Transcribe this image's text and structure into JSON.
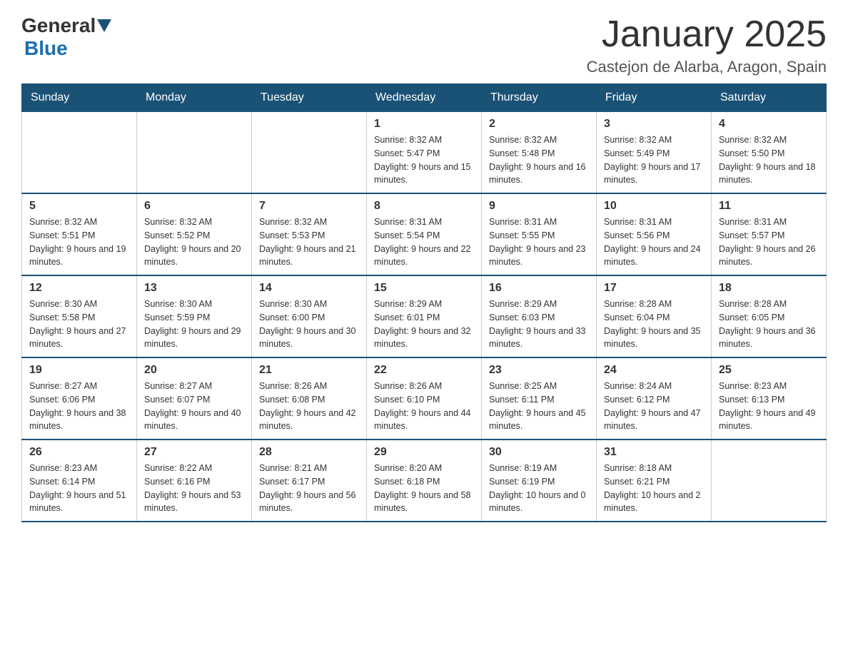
{
  "logo": {
    "general": "General",
    "blue": "Blue"
  },
  "title": "January 2025",
  "location": "Castejon de Alarba, Aragon, Spain",
  "headers": [
    "Sunday",
    "Monday",
    "Tuesday",
    "Wednesday",
    "Thursday",
    "Friday",
    "Saturday"
  ],
  "weeks": [
    [
      {
        "day": "",
        "info": ""
      },
      {
        "day": "",
        "info": ""
      },
      {
        "day": "",
        "info": ""
      },
      {
        "day": "1",
        "info": "Sunrise: 8:32 AM\nSunset: 5:47 PM\nDaylight: 9 hours and 15 minutes."
      },
      {
        "day": "2",
        "info": "Sunrise: 8:32 AM\nSunset: 5:48 PM\nDaylight: 9 hours and 16 minutes."
      },
      {
        "day": "3",
        "info": "Sunrise: 8:32 AM\nSunset: 5:49 PM\nDaylight: 9 hours and 17 minutes."
      },
      {
        "day": "4",
        "info": "Sunrise: 8:32 AM\nSunset: 5:50 PM\nDaylight: 9 hours and 18 minutes."
      }
    ],
    [
      {
        "day": "5",
        "info": "Sunrise: 8:32 AM\nSunset: 5:51 PM\nDaylight: 9 hours and 19 minutes."
      },
      {
        "day": "6",
        "info": "Sunrise: 8:32 AM\nSunset: 5:52 PM\nDaylight: 9 hours and 20 minutes."
      },
      {
        "day": "7",
        "info": "Sunrise: 8:32 AM\nSunset: 5:53 PM\nDaylight: 9 hours and 21 minutes."
      },
      {
        "day": "8",
        "info": "Sunrise: 8:31 AM\nSunset: 5:54 PM\nDaylight: 9 hours and 22 minutes."
      },
      {
        "day": "9",
        "info": "Sunrise: 8:31 AM\nSunset: 5:55 PM\nDaylight: 9 hours and 23 minutes."
      },
      {
        "day": "10",
        "info": "Sunrise: 8:31 AM\nSunset: 5:56 PM\nDaylight: 9 hours and 24 minutes."
      },
      {
        "day": "11",
        "info": "Sunrise: 8:31 AM\nSunset: 5:57 PM\nDaylight: 9 hours and 26 minutes."
      }
    ],
    [
      {
        "day": "12",
        "info": "Sunrise: 8:30 AM\nSunset: 5:58 PM\nDaylight: 9 hours and 27 minutes."
      },
      {
        "day": "13",
        "info": "Sunrise: 8:30 AM\nSunset: 5:59 PM\nDaylight: 9 hours and 29 minutes."
      },
      {
        "day": "14",
        "info": "Sunrise: 8:30 AM\nSunset: 6:00 PM\nDaylight: 9 hours and 30 minutes."
      },
      {
        "day": "15",
        "info": "Sunrise: 8:29 AM\nSunset: 6:01 PM\nDaylight: 9 hours and 32 minutes."
      },
      {
        "day": "16",
        "info": "Sunrise: 8:29 AM\nSunset: 6:03 PM\nDaylight: 9 hours and 33 minutes."
      },
      {
        "day": "17",
        "info": "Sunrise: 8:28 AM\nSunset: 6:04 PM\nDaylight: 9 hours and 35 minutes."
      },
      {
        "day": "18",
        "info": "Sunrise: 8:28 AM\nSunset: 6:05 PM\nDaylight: 9 hours and 36 minutes."
      }
    ],
    [
      {
        "day": "19",
        "info": "Sunrise: 8:27 AM\nSunset: 6:06 PM\nDaylight: 9 hours and 38 minutes."
      },
      {
        "day": "20",
        "info": "Sunrise: 8:27 AM\nSunset: 6:07 PM\nDaylight: 9 hours and 40 minutes."
      },
      {
        "day": "21",
        "info": "Sunrise: 8:26 AM\nSunset: 6:08 PM\nDaylight: 9 hours and 42 minutes."
      },
      {
        "day": "22",
        "info": "Sunrise: 8:26 AM\nSunset: 6:10 PM\nDaylight: 9 hours and 44 minutes."
      },
      {
        "day": "23",
        "info": "Sunrise: 8:25 AM\nSunset: 6:11 PM\nDaylight: 9 hours and 45 minutes."
      },
      {
        "day": "24",
        "info": "Sunrise: 8:24 AM\nSunset: 6:12 PM\nDaylight: 9 hours and 47 minutes."
      },
      {
        "day": "25",
        "info": "Sunrise: 8:23 AM\nSunset: 6:13 PM\nDaylight: 9 hours and 49 minutes."
      }
    ],
    [
      {
        "day": "26",
        "info": "Sunrise: 8:23 AM\nSunset: 6:14 PM\nDaylight: 9 hours and 51 minutes."
      },
      {
        "day": "27",
        "info": "Sunrise: 8:22 AM\nSunset: 6:16 PM\nDaylight: 9 hours and 53 minutes."
      },
      {
        "day": "28",
        "info": "Sunrise: 8:21 AM\nSunset: 6:17 PM\nDaylight: 9 hours and 56 minutes."
      },
      {
        "day": "29",
        "info": "Sunrise: 8:20 AM\nSunset: 6:18 PM\nDaylight: 9 hours and 58 minutes."
      },
      {
        "day": "30",
        "info": "Sunrise: 8:19 AM\nSunset: 6:19 PM\nDaylight: 10 hours and 0 minutes."
      },
      {
        "day": "31",
        "info": "Sunrise: 8:18 AM\nSunset: 6:21 PM\nDaylight: 10 hours and 2 minutes."
      },
      {
        "day": "",
        "info": ""
      }
    ]
  ]
}
